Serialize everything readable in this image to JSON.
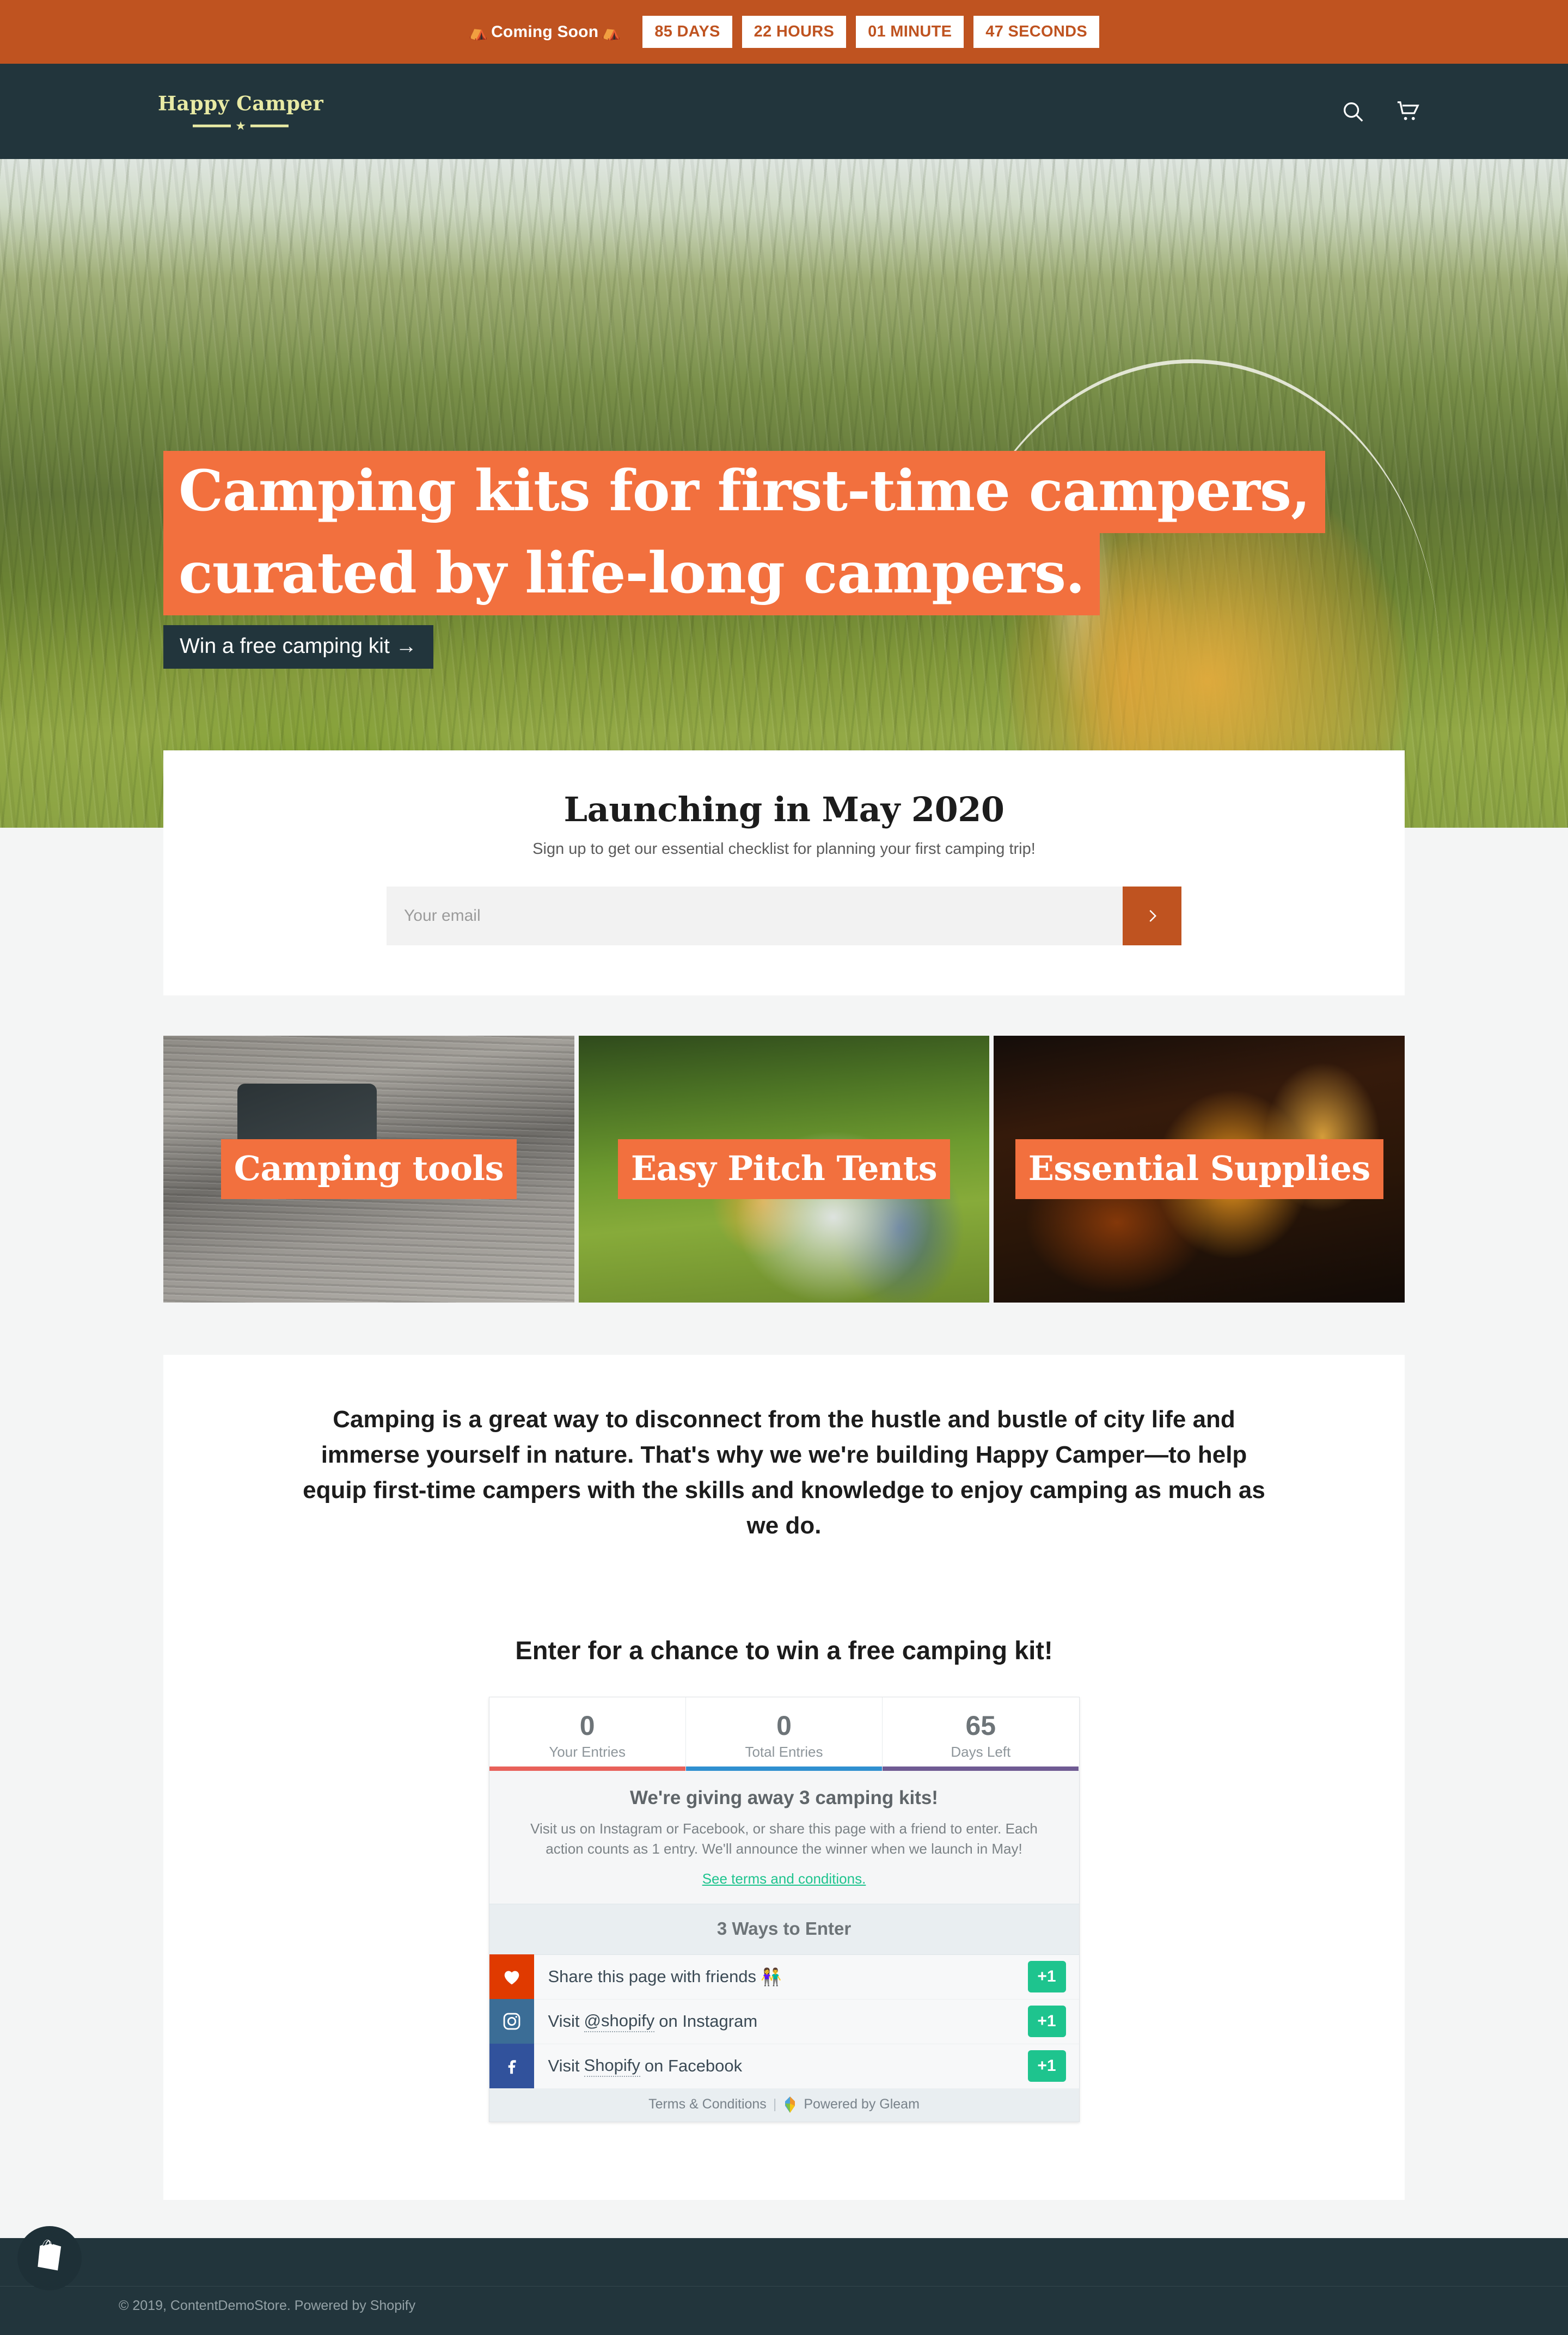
{
  "announcement": {
    "label": "Coming Soon",
    "emoji_left": "⛺",
    "emoji_right": "⛺",
    "countdown": [
      {
        "name": "days",
        "text": "85 DAYS"
      },
      {
        "name": "hours",
        "text": "22 HOURS"
      },
      {
        "name": "minutes",
        "text": "01 MINUTE"
      },
      {
        "name": "seconds",
        "text": "47 SECONDS"
      }
    ],
    "bg_color": "#bf5320",
    "chip_text_color": "#bf5320"
  },
  "header": {
    "logo_text": "Happy Camper",
    "logo_color": "#e8eaa4",
    "bg_color": "#22353c",
    "search_icon": "search-icon",
    "cart_icon": "cart-icon"
  },
  "hero": {
    "headline_line1": "Camping kits for first-time campers,",
    "headline_line2": "curated by life-long campers.",
    "cta_label": "Win a free camping kit →",
    "highlight_color": "#f2703e",
    "cta_bg_color": "#22353c"
  },
  "signup": {
    "title": "Launching in May 2020",
    "subtitle": "Sign up to get our essential checklist for planning your first camping trip!",
    "email_placeholder": "Your email",
    "email_value": "",
    "submit_icon": "chevron-right-icon",
    "submit_color": "#bf5320"
  },
  "categories": [
    {
      "label": "Camping tools",
      "theme": "tools"
    },
    {
      "label": "Easy Pitch Tents",
      "theme": "tents"
    },
    {
      "label": "Essential Supplies",
      "theme": "supplies"
    }
  ],
  "text_block": {
    "paragraph": "Camping is a great way to disconnect from the hustle and bustle of city life and immerse yourself in nature. That's why we we're building Happy Camper—to help equip first-time campers with the skills and knowledge to enjoy camping as much as we do."
  },
  "giveaway": {
    "title": "Enter for a chance to win a free camping kit!",
    "stats": [
      {
        "value": "0",
        "label": "Your Entries",
        "color": "#e8615a"
      },
      {
        "value": "0",
        "label": "Total Entries",
        "color": "#2f8fd0"
      },
      {
        "value": "65",
        "label": "Days Left",
        "color": "#6f5b93"
      }
    ],
    "heading": "We're giving away 3 camping kits!",
    "description": "Visit us on Instagram or Facebook, or share this page with a friend to enter. Each action counts as 1 entry. We'll announce the winner when we launch in May!",
    "terms_link": "See terms and conditions.",
    "ways_heading": "3 Ways to Enter",
    "entries": [
      {
        "icon": "heart-icon",
        "icon_class": "heart",
        "text_before": "Share this page with friends",
        "link_text": "",
        "text_after": "",
        "emoji": "👫",
        "points": "+1"
      },
      {
        "icon": "instagram-icon",
        "icon_class": "instagram",
        "text_before": "Visit",
        "link_text": "@shopify",
        "text_after": "on Instagram",
        "emoji": "",
        "points": "+1"
      },
      {
        "icon": "facebook-icon",
        "icon_class": "facebook",
        "text_before": "Visit",
        "link_text": "Shopify",
        "text_after": "on Facebook",
        "emoji": "",
        "points": "+1"
      }
    ],
    "footer_terms": "Terms & Conditions",
    "footer_powered": "Powered by Gleam",
    "accent_green": "#1ec48e"
  },
  "footer": {
    "copyright": "© 2019, ContentDemoStore. Powered by Shopify",
    "logo_icon": "shopify-bag-icon",
    "bg_color": "#22353c"
  }
}
